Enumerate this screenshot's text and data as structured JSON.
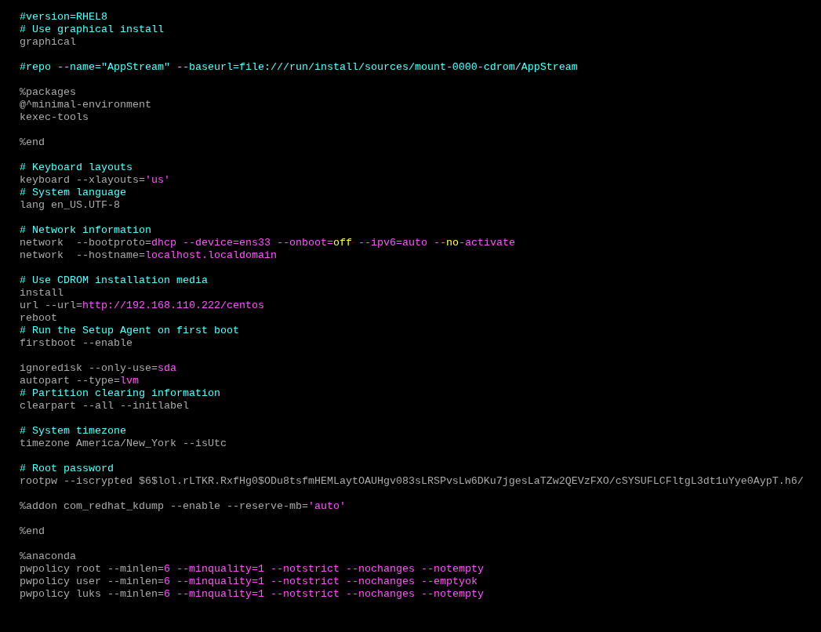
{
  "editor": {
    "blocks": [
      [
        {
          "segments": [
            {
              "kind": "comment",
              "text": "#version=RHEL8"
            }
          ]
        },
        {
          "segments": [
            {
              "kind": "comment",
              "text": "# Use graphical install"
            }
          ]
        },
        {
          "segments": [
            {
              "kind": "plain",
              "text": "graphical"
            }
          ]
        }
      ],
      [
        {
          "segments": [
            {
              "kind": "comment",
              "text": "#repo --name=\"AppStream\" --baseurl=file:///run/install/sources/mount-0000-cdrom/AppStream"
            }
          ]
        }
      ],
      [
        {
          "segments": [
            {
              "kind": "plain",
              "text": "%packages"
            }
          ]
        },
        {
          "segments": [
            {
              "kind": "plain",
              "text": "@^minimal-environment"
            }
          ]
        },
        {
          "segments": [
            {
              "kind": "plain",
              "text": "kexec-tools"
            }
          ]
        }
      ],
      [
        {
          "segments": [
            {
              "kind": "plain",
              "text": "%end"
            }
          ]
        }
      ],
      [
        {
          "segments": [
            {
              "kind": "comment",
              "text": "# Keyboard layouts"
            }
          ]
        },
        {
          "segments": [
            {
              "kind": "plain",
              "text": "keyboard --xlayouts="
            },
            {
              "kind": "string",
              "text": "'us'"
            }
          ]
        },
        {
          "segments": [
            {
              "kind": "comment",
              "text": "# System language"
            }
          ]
        },
        {
          "segments": [
            {
              "kind": "plain",
              "text": "lang en_US.UTF-8"
            }
          ]
        }
      ],
      [
        {
          "segments": [
            {
              "kind": "comment",
              "text": "# Network information"
            }
          ]
        },
        {
          "segments": [
            {
              "kind": "plain",
              "text": "network  --bootproto="
            },
            {
              "kind": "string",
              "text": "dhcp --device=ens33 --onboot="
            },
            {
              "kind": "keyword",
              "text": "off"
            },
            {
              "kind": "string",
              "text": " --ipv6=auto --"
            },
            {
              "kind": "keyword",
              "text": "no"
            },
            {
              "kind": "string",
              "text": "-activate"
            }
          ]
        },
        {
          "segments": [
            {
              "kind": "plain",
              "text": "network  --hostname="
            },
            {
              "kind": "string",
              "text": "localhost.localdomain"
            }
          ]
        }
      ],
      [
        {
          "segments": [
            {
              "kind": "comment",
              "text": "# Use CDROM installation media"
            }
          ]
        },
        {
          "segments": [
            {
              "kind": "plain",
              "text": "install"
            }
          ]
        },
        {
          "segments": [
            {
              "kind": "plain",
              "text": "url --url="
            },
            {
              "kind": "string",
              "text": "http://192.168.110.222/centos"
            }
          ]
        },
        {
          "segments": [
            {
              "kind": "plain",
              "text": "reboot"
            }
          ]
        },
        {
          "segments": [
            {
              "kind": "comment",
              "text": "# Run the Setup Agent on first boot"
            }
          ]
        },
        {
          "segments": [
            {
              "kind": "plain",
              "text": "firstboot --enable"
            }
          ]
        }
      ],
      [
        {
          "segments": [
            {
              "kind": "plain",
              "text": "ignoredisk --only-use="
            },
            {
              "kind": "string",
              "text": "sda"
            }
          ]
        },
        {
          "segments": [
            {
              "kind": "plain",
              "text": "autopart --type="
            },
            {
              "kind": "string",
              "text": "lvm"
            }
          ]
        },
        {
          "segments": [
            {
              "kind": "comment",
              "text": "# Partition clearing information"
            }
          ]
        },
        {
          "segments": [
            {
              "kind": "plain",
              "text": "clearpart --all --initlabel"
            }
          ]
        }
      ],
      [
        {
          "segments": [
            {
              "kind": "comment",
              "text": "# System timezone"
            }
          ]
        },
        {
          "segments": [
            {
              "kind": "plain",
              "text": "timezone America/New_York --isUtc"
            }
          ]
        }
      ],
      [
        {
          "segments": [
            {
              "kind": "comment",
              "text": "# Root password"
            }
          ]
        },
        {
          "segments": [
            {
              "kind": "plain",
              "text": "rootpw --iscrypted $6$lol.rLTKR.RxfHg0$ODu8tsfmHEMLaytOAUHgv083sLRSPvsLw6DKu7jgesLaTZw2QEVzFXO/cSYSUFLCFltgL3dt1uYye0AypT.h6/"
            }
          ]
        }
      ],
      [
        {
          "segments": [
            {
              "kind": "plain",
              "text": "%addon com_redhat_kdump --enable --reserve-mb="
            },
            {
              "kind": "string",
              "text": "'auto'"
            }
          ]
        }
      ],
      [
        {
          "segments": [
            {
              "kind": "plain",
              "text": "%end"
            }
          ]
        }
      ],
      [
        {
          "segments": [
            {
              "kind": "plain",
              "text": "%anaconda"
            }
          ]
        },
        {
          "segments": [
            {
              "kind": "plain",
              "text": "pwpolicy root --minlen="
            },
            {
              "kind": "string",
              "text": "6 --minquality=1 --notstrict --nochanges --notempty"
            }
          ]
        },
        {
          "segments": [
            {
              "kind": "plain",
              "text": "pwpolicy user --minlen="
            },
            {
              "kind": "string",
              "text": "6 --minquality=1 --notstrict --nochanges --emptyok"
            }
          ]
        },
        {
          "segments": [
            {
              "kind": "plain",
              "text": "pwpolicy luks --minlen="
            },
            {
              "kind": "string",
              "text": "6 --minquality=1 --notstrict --nochanges --notempty"
            }
          ]
        }
      ]
    ]
  }
}
